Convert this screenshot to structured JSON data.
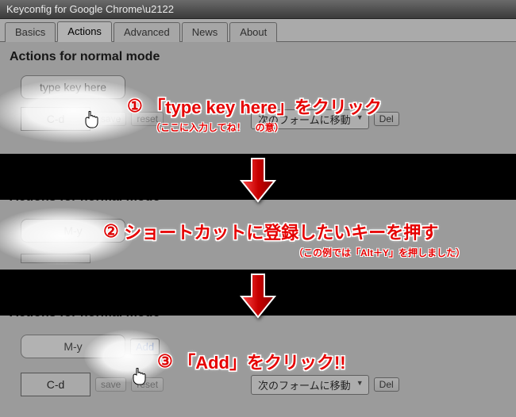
{
  "window": {
    "title": "Keyconfig for Google Chrome\\u2122"
  },
  "tabs": {
    "basics": "Basics",
    "actions": "Actions",
    "advanced": "Advanced",
    "news": "News",
    "about": "About"
  },
  "heading": "Actions for normal mode",
  "panel1": {
    "key_input_value": "type key here",
    "binding_key": "C-d",
    "save": "save",
    "reset": "reset",
    "action_select": "次のフォームに移動",
    "del": "Del"
  },
  "panel2": {
    "key_input_value": "M-y"
  },
  "panel3": {
    "key_input_value": "M-y",
    "add": "Add",
    "binding_key": "C-d",
    "save": "save",
    "reset": "reset",
    "action_select": "次のフォームに移動",
    "del": "Del"
  },
  "annot1": {
    "num": "①",
    "main": "「type key here」をクリック",
    "sub": "（ここに入力してね！　の意）"
  },
  "annot2": {
    "num": "②",
    "main": "ショートカットに登録したいキーを押す",
    "sub": "（この例では「Alt＋Y」を押しました）"
  },
  "annot3": {
    "num": "③",
    "main": "「Add」をクリック!!"
  }
}
